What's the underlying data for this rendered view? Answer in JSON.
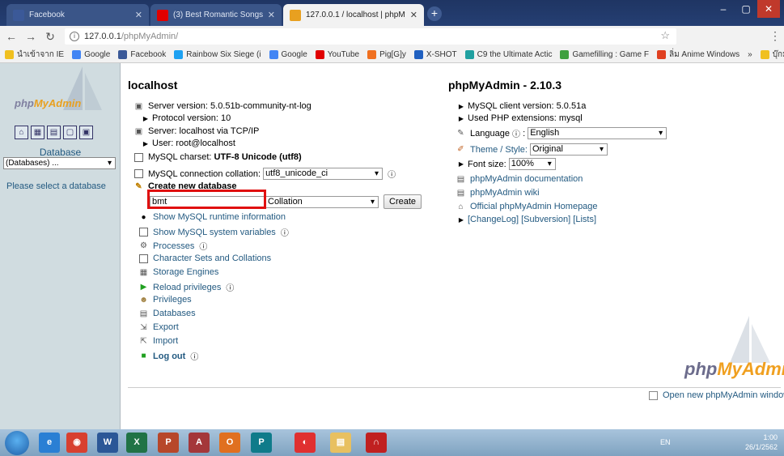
{
  "browser": {
    "tabs": [
      {
        "title": "Facebook",
        "favicon_color": "#3b5998"
      },
      {
        "title": "(3) Best Romantic Songs Lo",
        "favicon_color": "#e00000"
      },
      {
        "title": "127.0.0.1 / localhost | phpMyAdm",
        "favicon_color": "#e8a020"
      }
    ],
    "new_tab": "+",
    "window_controls": [
      "–",
      "▢",
      "✕"
    ],
    "url_host": "127.0.0.1",
    "url_path": "/phpMyAdmin/",
    "bookmarks": [
      {
        "label": "นำเข้าจาก IE",
        "color": "#f0c020"
      },
      {
        "label": "Google",
        "color": "#4285f4"
      },
      {
        "label": "Facebook",
        "color": "#3b5998"
      },
      {
        "label": "Rainbow Six Siege (i",
        "color": "#1da1f2"
      },
      {
        "label": "Google",
        "color": "#4285f4"
      },
      {
        "label": "YouTube",
        "color": "#e00000"
      },
      {
        "label": "Pig[G]y",
        "color": "#f07020"
      },
      {
        "label": "X-SHOT",
        "color": "#2060c0"
      },
      {
        "label": "C9 the Ultimate Actic",
        "color": "#20a0a0"
      },
      {
        "label": "Gamefilling : Game F",
        "color": "#40a040"
      },
      {
        "label": "ลิ่ม Anime Windows",
        "color": "#e04020"
      },
      {
        "label": "»",
        "color": "#f2f2f2"
      },
      {
        "label": "บุ๊กมาร์กอื่นๆ",
        "color": "#f0c020"
      }
    ]
  },
  "left": {
    "logo_text_a": "php",
    "logo_text_b": "MyAdmin",
    "icon_buttons": [
      "⌂",
      "▦",
      "▤",
      "▢",
      "▣"
    ],
    "database_label": "Database",
    "database_select": "(Databases) ...",
    "hint": "Please select a database"
  },
  "main": {
    "server_heading": "localhost",
    "server_version_label": "Server version: 5.0.51b-community-nt-log",
    "protocol": "Protocol version: 10",
    "server_via": "Server: localhost via TCP/IP",
    "user": "User: root@localhost",
    "charset_prefix": "MySQL charset:",
    "charset_value": "UTF-8 Unicode (utf8)",
    "collation_label": "MySQL connection collation:",
    "collation_value": "utf8_unicode_ci",
    "create_db_label": "Create new database",
    "new_db_name": "bmt",
    "collation_placeholder": "Collation",
    "create_button": "Create",
    "links": [
      "Show MySQL runtime information",
      "Show MySQL system variables",
      "Processes",
      "Character Sets and Collations",
      "Storage Engines",
      "Reload privileges",
      "Privileges",
      "Databases",
      "Export",
      "Import",
      "Log out"
    ]
  },
  "right": {
    "heading": "phpMyAdmin - 2.10.3",
    "mysql_client": "MySQL client version: 5.0.51a",
    "php_ext": "Used PHP extensions: mysql",
    "language_label": "Language",
    "language_value": "English",
    "theme_label": "Theme / Style:",
    "theme_value": "Original",
    "font_size_label": "Font size:",
    "font_size_value": "100%",
    "doc_link": "phpMyAdmin documentation",
    "wiki_link": "phpMyAdmin wiki",
    "home_link": "Official phpMyAdmin Homepage",
    "changelog": "[ChangeLog]",
    "subversion": "[Subversion]",
    "lists": "[Lists]",
    "new_window": "Open new phpMyAdmin window",
    "big_logo_a": "php",
    "big_logo_b": "MyAdmin"
  },
  "taskbar": {
    "apps": [
      {
        "label": "e",
        "color": "#2a7fd4"
      },
      {
        "label": "◉",
        "color": "#d84030"
      },
      {
        "label": "W",
        "color": "#2b5797"
      },
      {
        "label": "X",
        "color": "#217346"
      },
      {
        "label": "P",
        "color": "#b7472a"
      },
      {
        "label": "A",
        "color": "#a4373a"
      },
      {
        "label": "O",
        "color": "#e07020"
      },
      {
        "label": "P",
        "color": "#0f7b8a"
      },
      {
        "label": "◐",
        "color": "#e03030"
      },
      {
        "label": "▤",
        "color": "#e8c060"
      },
      {
        "label": "∩",
        "color": "#c02020"
      }
    ],
    "lang": "EN",
    "time": "1:00",
    "date": "26/1/2562"
  }
}
